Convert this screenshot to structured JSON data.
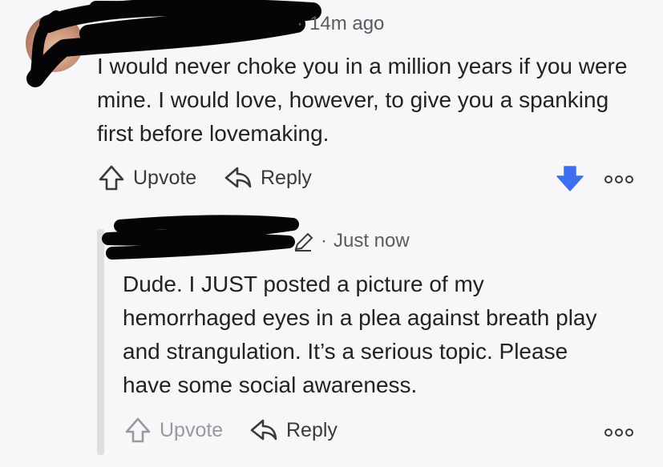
{
  "comment": {
    "time": "14m ago",
    "body": "I would never choke you in a million years if you were mine. I would love, however, to give you a spanking first before lovemaking.",
    "upvote_label": "Upvote",
    "reply_label": "Reply",
    "vote_state": "downvoted",
    "accent": "#3d6ff0"
  },
  "reply": {
    "time": "Just now",
    "body": "Dude. I JUST posted a picture of my hemorrhaged eyes in a plea against breath play and strangulation. It’s a serious topic. Please have some social awareness.",
    "upvote_label": "Upvote",
    "reply_label": "Reply"
  },
  "icons": [
    "upvote-arrow-icon",
    "reply-arrow-icon",
    "downvote-arrow-icon",
    "more-options-icon",
    "pencil-icon"
  ]
}
